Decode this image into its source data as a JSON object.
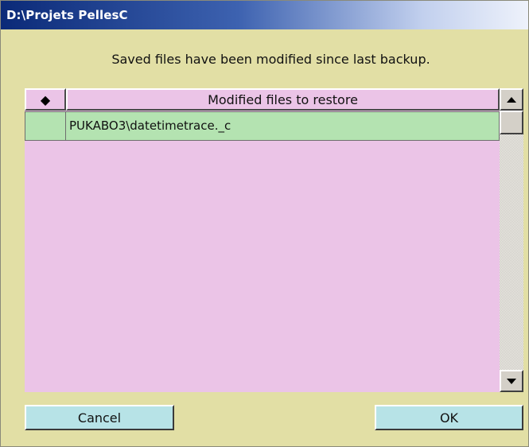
{
  "window": {
    "title": "D:\\Projets PellesC"
  },
  "message": "Saved files have been modified since last backup.",
  "list": {
    "mark_header": "◆",
    "files_header": "Modified files to restore",
    "rows": [
      {
        "mark": "",
        "name": "PUKABO3\\datetimetrace._c"
      }
    ]
  },
  "buttons": {
    "cancel": "Cancel",
    "ok": "OK"
  },
  "colors": {
    "dialog_bg": "#e2dfa5",
    "list_bg": "#ebc4e7",
    "row_bg": "#b4e3b1",
    "button_bg": "#b7e3e7",
    "titlebar_start": "#0b2a78"
  },
  "icons": {
    "scroll_up": "triangle-up-icon",
    "scroll_down": "triangle-down-icon",
    "header_mark": "diamond-icon"
  }
}
